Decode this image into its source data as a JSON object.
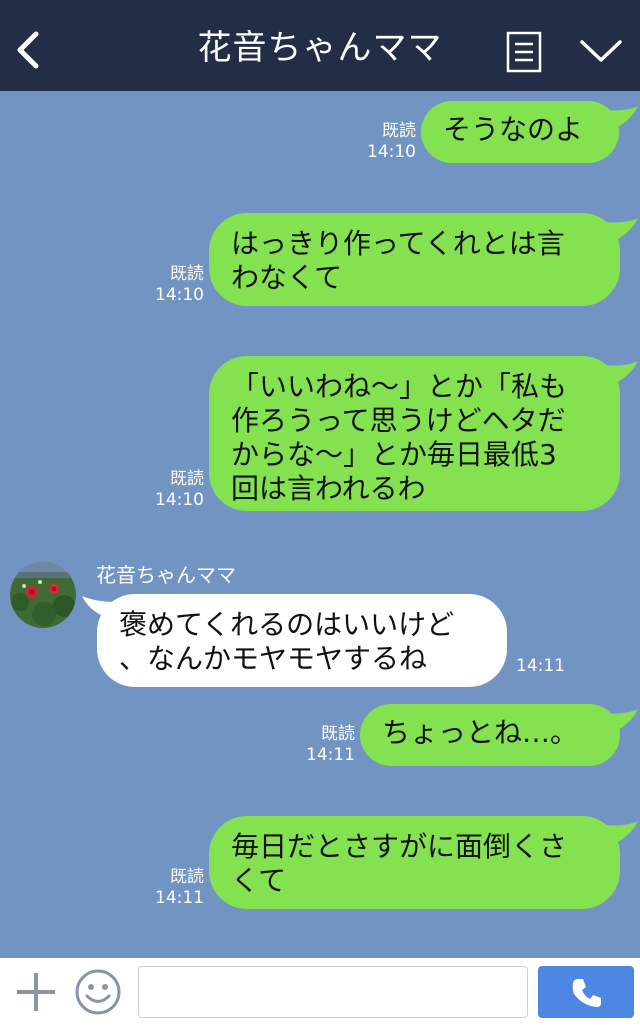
{
  "header": {
    "title": "花音ちゃんママ",
    "back_icon": "chevron-left-icon",
    "menu_icon": "menu-list-icon",
    "collapse_icon": "chevron-down-icon",
    "background": "#232d45"
  },
  "chat": {
    "background": "#7294c3",
    "messages": [
      {
        "side": "right",
        "lines": [
          "そうなのよ"
        ],
        "read": "既読",
        "time": "14:10"
      },
      {
        "side": "right",
        "lines": [
          "はっきり作ってくれとは言",
          "わなくて"
        ],
        "read": "既読",
        "time": "14:10"
      },
      {
        "side": "right",
        "lines": [
          "「いいわね〜」とか「私も",
          "作ろうって思うけどヘタだ",
          "からな〜」とか毎日最低3",
          "回は言われるわ"
        ],
        "read": "既読",
        "time": "14:10"
      },
      {
        "side": "left",
        "sender": "花音ちゃんママ",
        "lines": [
          "褒めてくれるのはいいけど",
          "、なんかモヤモヤするね"
        ],
        "time": "14:11"
      },
      {
        "side": "right",
        "lines": [
          "ちょっとね…。"
        ],
        "read": "既読",
        "time": "14:11"
      },
      {
        "side": "right",
        "lines": [
          "毎日だとさすがに面倒くさ",
          "くて"
        ],
        "read": "既読",
        "time": "14:11"
      }
    ],
    "sent_bubble_color": "#84e251",
    "received_bubble_color": "#ffffff"
  },
  "input_bar": {
    "plus_icon": "plus-icon",
    "emoji_icon": "smile-icon",
    "input_value": "",
    "call_icon": "phone-icon",
    "call_color": "#4e86e4"
  }
}
